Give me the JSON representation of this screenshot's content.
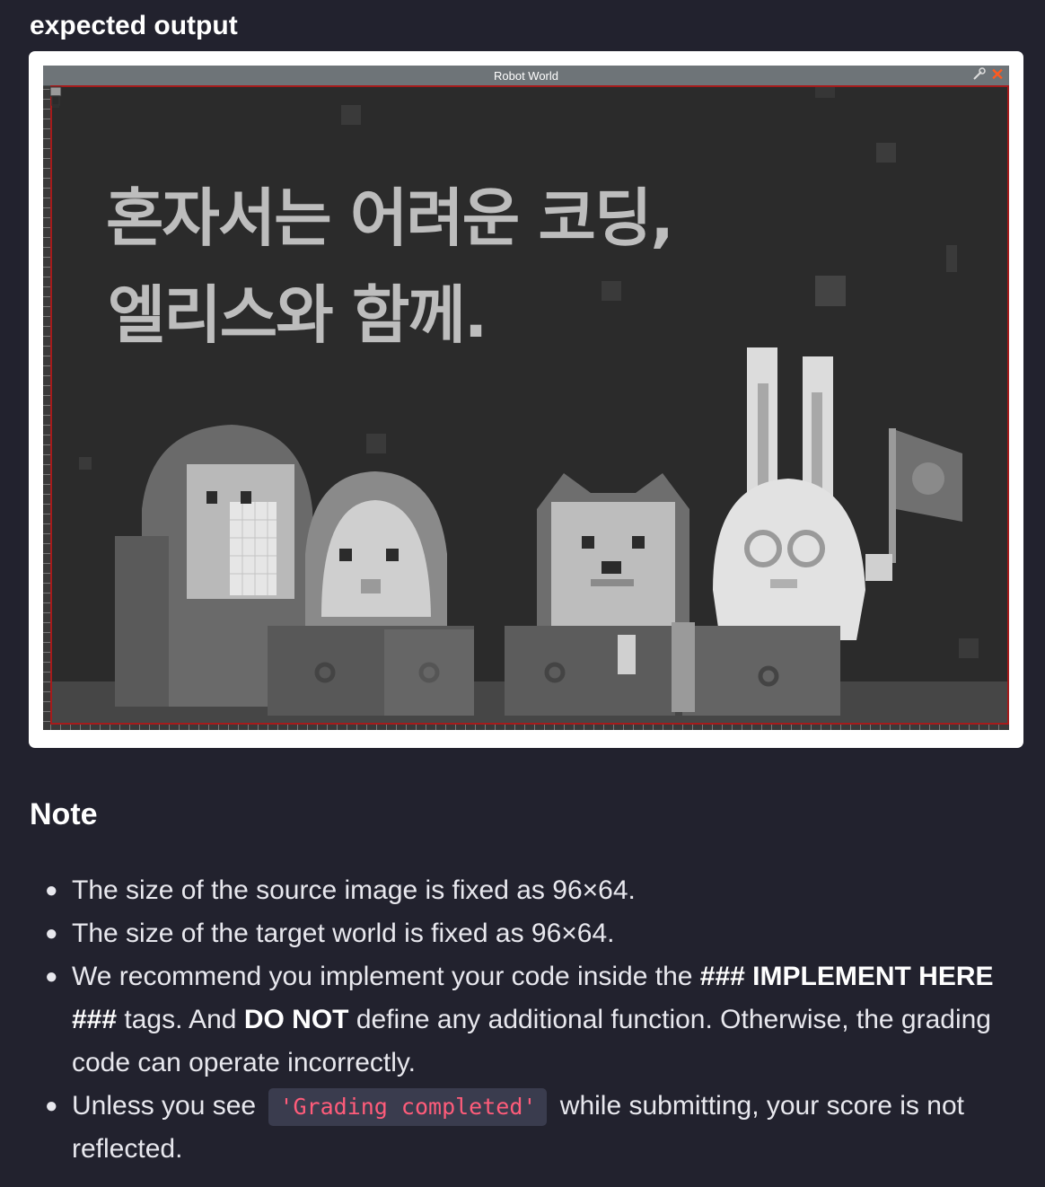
{
  "section_title": "expected output",
  "robot_world": {
    "title": "Robot World",
    "icons": [
      "wrench-icon",
      "close-icon",
      "robot-icon"
    ],
    "canvas_text_line1": "혼자서는 어려운 코딩,",
    "canvas_text_line2": "엘리스와 함께.",
    "accent_border": "#a61b1b",
    "background": "#2b2b2b"
  },
  "note": {
    "title": "Note",
    "bullets": {
      "b1": "The size of the source image is fixed as 96×64.",
      "b2": "The size of the target world is fixed as 96×64.",
      "b3_pre": "We recommend you implement your code inside the ",
      "b3_bold1": "### IMPLEMENT HERE ###",
      "b3_mid": " tags. And ",
      "b3_bold2": "DO NOT",
      "b3_post": " define any additional function. Otherwise, the grading code can operate incorrectly.",
      "b4_pre": "Unless you see ",
      "b4_code": "'Grading completed'",
      "b4_post": " while submitting, your score is not reflected."
    }
  },
  "colors": {
    "page_bg": "#22222e",
    "code_text": "#ff5c7a",
    "code_bg": "#3a3c4e"
  }
}
